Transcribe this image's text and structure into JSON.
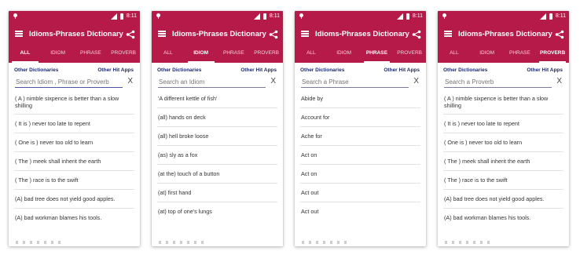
{
  "status_time": "8:11",
  "app_title": "Idioms-Phrases Dictionary",
  "tabs": [
    "ALL",
    "IDIOM",
    "PHRASE",
    "PROVERB"
  ],
  "links": {
    "other_dictionaries": "Other Dictionaries",
    "other_apps": "Other Hit Apps"
  },
  "icons": {
    "menu": "menu-icon",
    "share": "share-icon",
    "clear": "close-icon"
  },
  "colors": {
    "primary": "#b51a48",
    "link": "#1d2a6b"
  },
  "screens": [
    {
      "active_tab": 0,
      "search_placeholder": "Search Idiom , Phrase or Proverb",
      "items": [
        "( A ) nimble sixpence is better than a slow shilling",
        "( It is ) never too late to repent",
        "( One is ) never too old to learn",
        "( The ) meek shall inherit the earth",
        "( The ) race is to the swift",
        "(A) bad tree does not yield good apples.",
        "(A) bad workman blames his tools."
      ]
    },
    {
      "active_tab": 1,
      "search_placeholder": "Search an Idiom",
      "items": [
        "'A different kettle of fish'",
        "(all) hands on deck",
        "(all) hell broke loose",
        "(as) sly as a fox",
        "(at the) touch of a button",
        "(at) first hand",
        "(at) top of one's lungs"
      ]
    },
    {
      "active_tab": 2,
      "search_placeholder": "Search a Phrase",
      "items": [
        "Abide by",
        "Account for",
        "Ache for",
        "Act on",
        "Act on",
        "Act out",
        "Act out"
      ]
    },
    {
      "active_tab": 3,
      "search_placeholder": "Search a Proverb",
      "items": [
        "( A ) nimble sixpence is better than a slow shilling",
        "( It is ) never too late to repent",
        "( One is ) never too old to learn",
        "( The ) meek shall inherit the earth",
        "( The ) race is to the swift",
        "(A) bad tree does not yield good apples.",
        "(A) bad workman blames his tools."
      ]
    }
  ]
}
